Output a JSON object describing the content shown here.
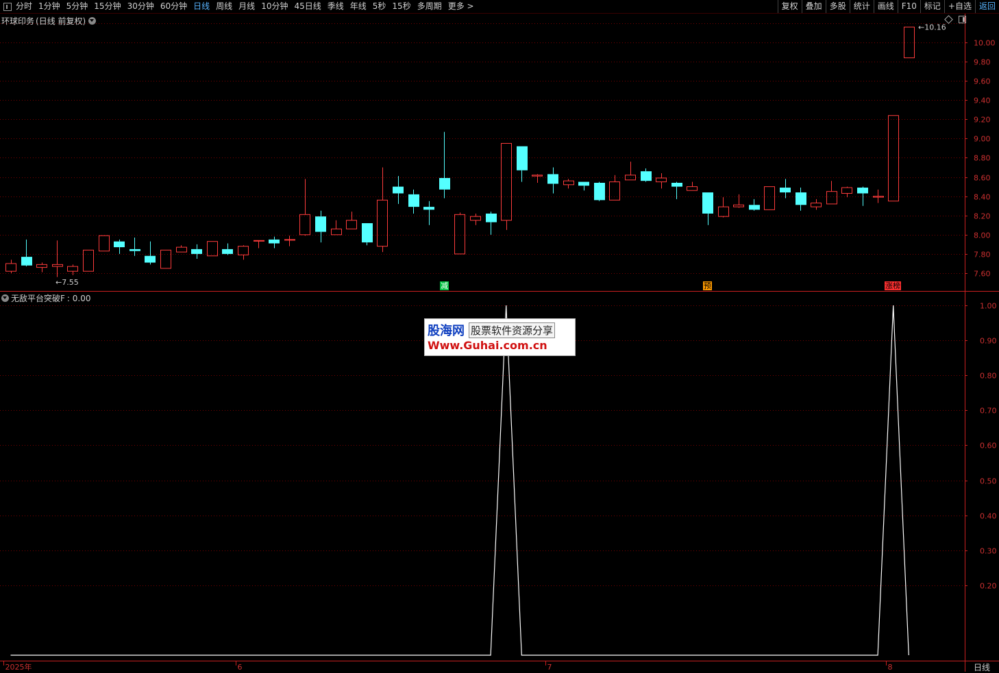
{
  "toolbar": {
    "periods": [
      "分时",
      "1分钟",
      "5分钟",
      "15分钟",
      "30分钟",
      "60分钟",
      "日线",
      "周线",
      "月线",
      "10分钟",
      "45日线",
      "季线",
      "年线",
      "5秒",
      "15秒",
      "多周期",
      "更多 >"
    ],
    "active_period": "日线",
    "actions": [
      "复权",
      "叠加",
      "多股",
      "统计",
      "画线",
      "F10",
      "标记",
      "+自选",
      "返回"
    ]
  },
  "stock": {
    "name": "环球印务",
    "mode": "(日线 前复权)"
  },
  "indicator": {
    "name": "无敌平台突破F",
    "value_text": ": 0.00"
  },
  "period_label": "日线",
  "watermark": {
    "brand": "股海网",
    "slogan": "股票软件资源分享",
    "url": "Www.Guhai.com.cn"
  },
  "colors": {
    "up": "#ff3c3c",
    "down": "#54ffff",
    "grid": "#7a0000",
    "axis": "#cc2020",
    "signal_line": "#ffffff",
    "tag_jian": "#00c040",
    "tag_yu": "#ff9a00",
    "tag_zhangting": "#ff3030"
  },
  "chart_data": [
    {
      "type": "candlestick",
      "title": "环球印务 (日线 前复权)",
      "ylim": [
        7.48,
        10.22
      ],
      "y_ticks": [
        7.6,
        7.8,
        8.0,
        8.2,
        8.4,
        8.6,
        8.8,
        9.0,
        9.2,
        9.4,
        9.6,
        9.8,
        10.0
      ],
      "y_tick_labels": [
        "7.60",
        "7.80",
        "8.00",
        "8.20",
        "8.40",
        "8.60",
        "8.80",
        "9.00",
        "9.20",
        "9.40",
        "9.60",
        "9.80",
        "10.00"
      ],
      "high_marker": "10.16",
      "low_marker": "7.55",
      "candles": [
        {
          "o": 7.62,
          "h": 7.74,
          "l": 7.6,
          "c": 7.7
        },
        {
          "o": 7.77,
          "h": 7.95,
          "l": 7.67,
          "c": 7.68
        },
        {
          "o": 7.66,
          "h": 7.71,
          "l": 7.61,
          "c": 7.69
        },
        {
          "o": 7.67,
          "h": 7.94,
          "l": 7.56,
          "c": 7.69
        },
        {
          "o": 7.62,
          "h": 7.69,
          "l": 7.58,
          "c": 7.67
        },
        {
          "o": 7.62,
          "h": 7.84,
          "l": 7.62,
          "c": 7.84
        },
        {
          "o": 7.83,
          "h": 7.99,
          "l": 7.83,
          "c": 7.99
        },
        {
          "o": 7.93,
          "h": 7.95,
          "l": 7.8,
          "c": 7.87
        },
        {
          "o": 7.85,
          "h": 7.97,
          "l": 7.78,
          "c": 7.83
        },
        {
          "o": 7.78,
          "h": 7.93,
          "l": 7.69,
          "c": 7.71
        },
        {
          "o": 7.65,
          "h": 7.84,
          "l": 7.65,
          "c": 7.84
        },
        {
          "o": 7.82,
          "h": 7.89,
          "l": 7.82,
          "c": 7.87
        },
        {
          "o": 7.85,
          "h": 7.9,
          "l": 7.75,
          "c": 7.8
        },
        {
          "o": 7.78,
          "h": 7.93,
          "l": 7.78,
          "c": 7.93
        },
        {
          "o": 7.85,
          "h": 7.91,
          "l": 7.79,
          "c": 7.8
        },
        {
          "o": 7.79,
          "h": 7.89,
          "l": 7.74,
          "c": 7.88
        },
        {
          "o": 7.94,
          "h": 7.94,
          "l": 7.86,
          "c": 7.94
        },
        {
          "o": 7.95,
          "h": 7.98,
          "l": 7.86,
          "c": 7.91
        },
        {
          "o": 7.95,
          "h": 7.99,
          "l": 7.88,
          "c": 7.95
        },
        {
          "o": 8.0,
          "h": 8.58,
          "l": 7.99,
          "c": 8.21
        },
        {
          "o": 8.19,
          "h": 8.25,
          "l": 7.92,
          "c": 8.03
        },
        {
          "o": 8.0,
          "h": 8.15,
          "l": 8.0,
          "c": 8.06
        },
        {
          "o": 8.06,
          "h": 8.24,
          "l": 8.06,
          "c": 8.15
        },
        {
          "o": 8.12,
          "h": 8.12,
          "l": 7.89,
          "c": 7.92
        },
        {
          "o": 7.88,
          "h": 8.7,
          "l": 7.82,
          "c": 8.36
        },
        {
          "o": 8.5,
          "h": 8.61,
          "l": 8.32,
          "c": 8.43
        },
        {
          "o": 8.42,
          "h": 8.47,
          "l": 8.22,
          "c": 8.29
        },
        {
          "o": 8.29,
          "h": 8.35,
          "l": 8.1,
          "c": 8.26
        },
        {
          "o": 8.59,
          "h": 9.07,
          "l": 8.38,
          "c": 8.47
        },
        {
          "o": 7.8,
          "h": 8.23,
          "l": 7.8,
          "c": 8.21
        },
        {
          "o": 8.15,
          "h": 8.22,
          "l": 8.1,
          "c": 8.19
        },
        {
          "o": 8.22,
          "h": 8.24,
          "l": 8.0,
          "c": 8.13
        },
        {
          "o": 8.15,
          "h": 8.95,
          "l": 8.05,
          "c": 8.95
        },
        {
          "o": 8.92,
          "h": 8.92,
          "l": 8.55,
          "c": 8.67
        },
        {
          "o": 8.61,
          "h": 8.63,
          "l": 8.54,
          "c": 8.62
        },
        {
          "o": 8.63,
          "h": 8.7,
          "l": 8.43,
          "c": 8.53
        },
        {
          "o": 8.52,
          "h": 8.58,
          "l": 8.48,
          "c": 8.56
        },
        {
          "o": 8.55,
          "h": 8.55,
          "l": 8.46,
          "c": 8.51
        },
        {
          "o": 8.54,
          "h": 8.55,
          "l": 8.35,
          "c": 8.36
        },
        {
          "o": 8.36,
          "h": 8.62,
          "l": 8.36,
          "c": 8.55
        },
        {
          "o": 8.57,
          "h": 8.76,
          "l": 8.57,
          "c": 8.62
        },
        {
          "o": 8.66,
          "h": 8.69,
          "l": 8.55,
          "c": 8.56
        },
        {
          "o": 8.55,
          "h": 8.64,
          "l": 8.48,
          "c": 8.59
        },
        {
          "o": 8.54,
          "h": 8.55,
          "l": 8.37,
          "c": 8.5
        },
        {
          "o": 8.46,
          "h": 8.55,
          "l": 8.46,
          "c": 8.5
        },
        {
          "o": 8.44,
          "h": 8.44,
          "l": 8.1,
          "c": 8.22
        },
        {
          "o": 8.19,
          "h": 8.39,
          "l": 8.18,
          "c": 8.29
        },
        {
          "o": 8.29,
          "h": 8.42,
          "l": 8.28,
          "c": 8.31
        },
        {
          "o": 8.31,
          "h": 8.37,
          "l": 8.25,
          "c": 8.26
        },
        {
          "o": 8.26,
          "h": 8.5,
          "l": 8.26,
          "c": 8.5
        },
        {
          "o": 8.49,
          "h": 8.58,
          "l": 8.38,
          "c": 8.44
        },
        {
          "o": 8.44,
          "h": 8.49,
          "l": 8.25,
          "c": 8.31
        },
        {
          "o": 8.29,
          "h": 8.37,
          "l": 8.26,
          "c": 8.33
        },
        {
          "o": 8.32,
          "h": 8.56,
          "l": 8.32,
          "c": 8.45
        },
        {
          "o": 8.43,
          "h": 8.5,
          "l": 8.39,
          "c": 8.49
        },
        {
          "o": 8.49,
          "h": 8.5,
          "l": 8.3,
          "c": 8.43
        },
        {
          "o": 8.39,
          "h": 8.47,
          "l": 8.33,
          "c": 8.4
        },
        {
          "o": 8.35,
          "h": 9.24,
          "l": 8.35,
          "c": 9.24
        },
        {
          "o": 9.84,
          "h": 10.16,
          "l": 9.84,
          "c": 10.16
        }
      ],
      "signals": [
        {
          "index": 28,
          "label": "减",
          "color_key": "tag_jian"
        },
        {
          "index": 45,
          "label": "预",
          "color_key": "tag_yu"
        },
        {
          "index": 57,
          "label": "涨榜",
          "color_key": "tag_zhangting"
        }
      ],
      "x_tick_labels": [
        {
          "index": 0,
          "label": "2025年"
        },
        {
          "index": 15,
          "label": "6"
        },
        {
          "index": 35,
          "label": "7"
        },
        {
          "index": 57,
          "label": "8"
        }
      ]
    },
    {
      "type": "line",
      "title": "无敌平台突破F",
      "ylim": [
        -0.01,
        1.02
      ],
      "y_ticks": [
        0.2,
        0.3,
        0.4,
        0.5,
        0.6,
        0.7,
        0.8,
        0.9,
        1.0
      ],
      "y_tick_labels": [
        "0.20",
        "0.30",
        "0.40",
        "0.50",
        "0.60",
        "0.70",
        "0.80",
        "0.90",
        "1.00"
      ],
      "series": [
        {
          "values": [
            0,
            0,
            0,
            0,
            0,
            0,
            0,
            0,
            0,
            0,
            0,
            0,
            0,
            0,
            0,
            0,
            0,
            0,
            0,
            0,
            0,
            0,
            0,
            0,
            0,
            0,
            0,
            0,
            0,
            0,
            0,
            0,
            1,
            0,
            0,
            0,
            0,
            0,
            0,
            0,
            0,
            0,
            0,
            0,
            0,
            0,
            0,
            0,
            0,
            0,
            0,
            0,
            0,
            0,
            0,
            0,
            0,
            1,
            0
          ]
        }
      ]
    }
  ]
}
